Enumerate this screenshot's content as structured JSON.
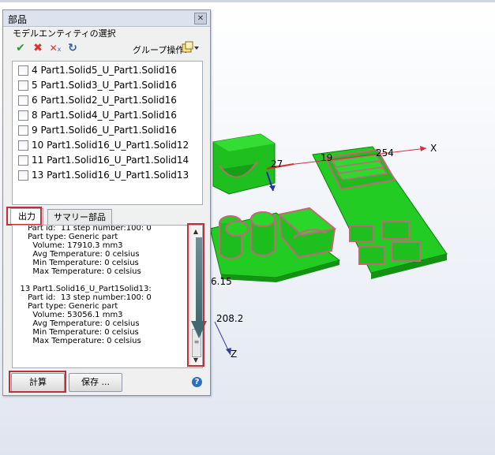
{
  "panel": {
    "title": "部品",
    "close_glyph": "✕",
    "group_label": "モデルエンティティの選択",
    "toolbar": {
      "icons": [
        "check-all-icon",
        "uncheck-icon",
        "clear-icon",
        "refresh-icon"
      ],
      "group_ops_label": "グループ操作:"
    },
    "entities": [
      {
        "label": "4 Part1.Solid5_U_Part1.Solid16",
        "checked": false
      },
      {
        "label": "5 Part1.Solid3_U_Part1.Solid16",
        "checked": false
      },
      {
        "label": "6 Part1.Solid2_U_Part1.Solid16",
        "checked": false
      },
      {
        "label": "8 Part1.Solid4_U_Part1.Solid16",
        "checked": false
      },
      {
        "label": "9 Part1.Solid6_U_Part1.Solid16",
        "checked": false
      },
      {
        "label": "10 Part1.Solid16_U_Part1.Solid12",
        "checked": false
      },
      {
        "label": "11 Part1.Solid16_U_Part1.Solid14",
        "checked": false
      },
      {
        "label": "13 Part1.Solid16_U_Part1.Solid13",
        "checked": false
      }
    ],
    "tabs": [
      {
        "label": "出力",
        "active": true
      },
      {
        "label": "サマリー部品",
        "active": false
      }
    ],
    "output_lines": [
      "      Part id:  11 step number:100: 0",
      "      Part type: Generic part",
      "        Volume: 17910.3 mm3",
      "        Avg Temperature: 0 celsius",
      "        Min Temperature: 0 celsius",
      "        Max Temperature: 0 celsius",
      "",
      "   13 Part1.Solid16_U_Part1Solid13:",
      "      Part id:  13 step number:100: 0",
      "      Part type: Generic part",
      "        Volume: 53056.1 mm3",
      "        Avg Temperature: 0 celsius",
      "        Min Temperature: 0 celsius",
      "        Max Temperature: 0 celsius"
    ],
    "buttons": {
      "calculate": "計算",
      "save": "保存 ..."
    },
    "help_glyph": "?"
  },
  "viewport": {
    "labels": {
      "x_axis": "X",
      "z_axis": "Z",
      "val_254": "254",
      "val_19": "19",
      "val_27": "27",
      "val_6_15": "6.15",
      "val_208_2": "208.2"
    },
    "colors": {
      "part_green": "#22cc22",
      "part_dark": "#128a12",
      "outline": "#c06a78",
      "x_axis": "#d0303a",
      "z_axis": "#3a3aa0",
      "highlight": "#c0303a"
    }
  }
}
